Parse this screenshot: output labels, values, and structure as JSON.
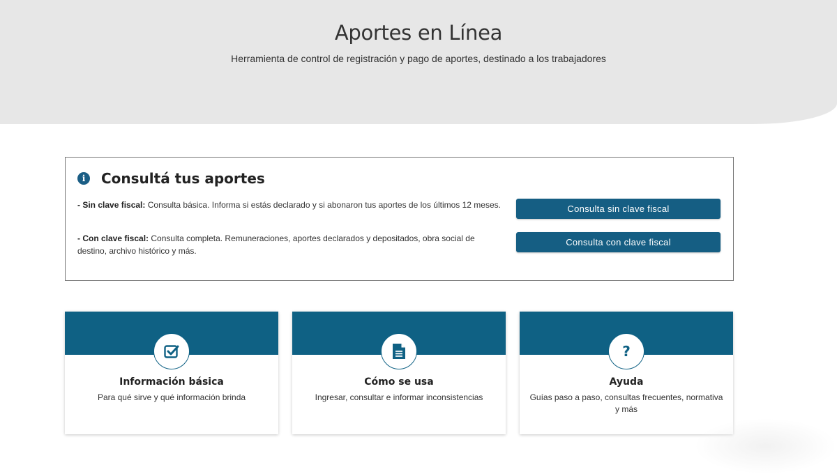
{
  "header": {
    "title": "Aportes en Línea",
    "subtitle": "Herramienta de control de registración y pago de aportes, destinado a los trabajadores"
  },
  "consulta": {
    "title": "Consultá tus aportes",
    "options": [
      {
        "label": "- Sin clave fiscal:",
        "text": " Consulta básica. Informa si estás declarado y si abonaron tus aportes de los últimos 12 meses.",
        "button": "Consulta sin clave fiscal"
      },
      {
        "label": "- Con clave fiscal:",
        "text": " Consulta completa. Remuneraciones, aportes declarados y depositados, obra social de destino, archivo histórico y más.",
        "button": "Consulta con clave fiscal"
      }
    ]
  },
  "cards": [
    {
      "icon": "checkbox-icon",
      "title": "Información básica",
      "desc": "Para qué sirve y qué información brinda"
    },
    {
      "icon": "document-icon",
      "title": "Cómo se usa",
      "desc": "Ingresar, consultar e informar inconsistencias"
    },
    {
      "icon": "question-icon",
      "title": "Ayuda",
      "desc": "Guías paso a paso, consultas frecuentes, normativa y más"
    }
  ],
  "colors": {
    "primary": "#0f6184",
    "hero_bg": "#e7e7e7"
  }
}
